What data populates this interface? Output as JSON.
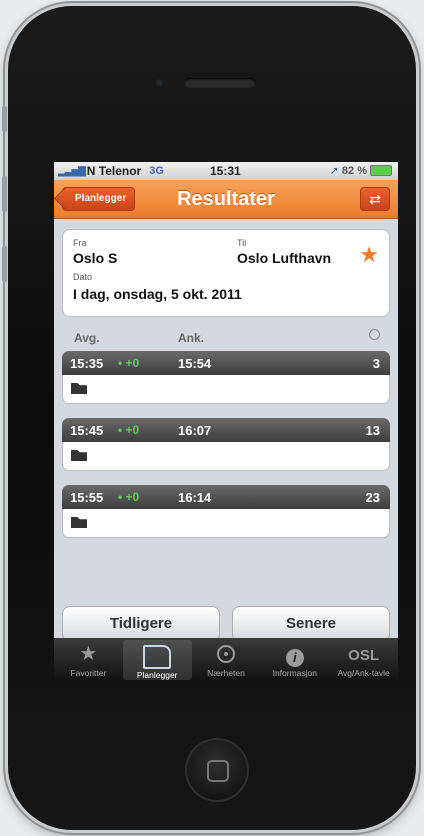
{
  "status_bar": {
    "carrier": "N Telenor",
    "network": "3G",
    "time": "15:31",
    "battery": "82 %"
  },
  "nav": {
    "back_label": "Planlegger",
    "title": "Resultater"
  },
  "journey": {
    "from_label": "Fra",
    "from_value": "Oslo S",
    "to_label": "Til",
    "to_value": "Oslo Lufthavn",
    "date_label": "Dato",
    "date_value": "I dag, onsdag, 5 okt. 2011"
  },
  "columns": {
    "departure": "Avg.",
    "arrival": "Ank."
  },
  "trips": [
    {
      "departure": "15:35",
      "delay": "• +0",
      "arrival": "15:54",
      "count": "3"
    },
    {
      "departure": "15:45",
      "delay": "• +0",
      "arrival": "16:07",
      "count": "13"
    },
    {
      "departure": "15:55",
      "delay": "• +0",
      "arrival": "16:14",
      "count": "23"
    }
  ],
  "buttons": {
    "earlier": "Tidligere",
    "later": "Senere"
  },
  "tabs": [
    {
      "label": "Favoritter",
      "icon": "star-icon"
    },
    {
      "label": "Planlegger",
      "icon": "planner-icon"
    },
    {
      "label": "Nærheten",
      "icon": "location-icon"
    },
    {
      "label": "Informasjon",
      "icon": "info-icon"
    },
    {
      "label": "Avg/Ank-tavle",
      "icon": "osl-logo-icon"
    }
  ],
  "osl_logo_text": "OSL",
  "colors": {
    "accent": "#ec7b28",
    "delay_green": "#5ad15a"
  }
}
